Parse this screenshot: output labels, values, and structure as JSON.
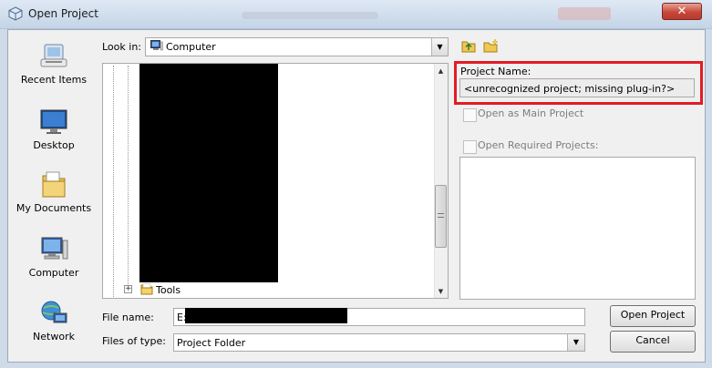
{
  "window": {
    "title": "Open Project",
    "close_glyph": "✕"
  },
  "places": [
    {
      "label": "Recent Items",
      "icon": "recent-items-icon"
    },
    {
      "label": "Desktop",
      "icon": "desktop-icon"
    },
    {
      "label": "My Documents",
      "icon": "my-documents-icon"
    },
    {
      "label": "Computer",
      "icon": "computer-icon"
    },
    {
      "label": "Network",
      "icon": "network-icon"
    }
  ],
  "lookin": {
    "label": "Look in:",
    "value": "Computer"
  },
  "tree": {
    "visible_item": "Tools",
    "expander_glyph": "+"
  },
  "project": {
    "name_label": "Project Name:",
    "name_value": "<unrecognized project; missing plug-in?>",
    "open_main_label": "Open as Main Project",
    "open_required_label": "Open Required Projects:"
  },
  "fields": {
    "filename_label": "File name:",
    "filename_value": "E:",
    "filetype_label": "Files of type:",
    "filetype_value": "Project Folder"
  },
  "buttons": {
    "open": "Open Project",
    "cancel": "Cancel"
  },
  "colors": {
    "highlight": "#e21c24",
    "close_button": "#c7483a"
  }
}
